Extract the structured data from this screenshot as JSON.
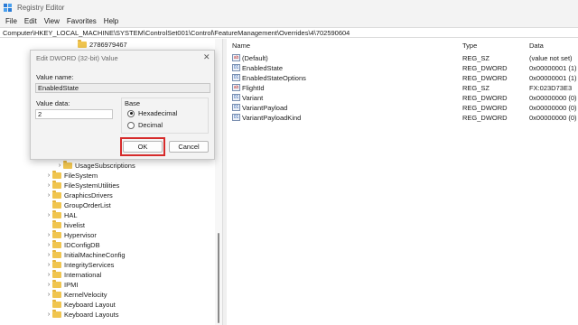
{
  "window": {
    "title": "Registry Editor",
    "icon": "registry-icon"
  },
  "menu": [
    "File",
    "Edit",
    "View",
    "Favorites",
    "Help"
  ],
  "address": "Computer\\HKEY_LOCAL_MACHINE\\SYSTEM\\ControlSet001\\Control\\FeatureManagement\\Overrides\\4\\702590604",
  "tree": {
    "top_item": "2786979467",
    "items": [
      "UsageSubscriptions",
      "FileSystem",
      "FileSystemUtilities",
      "GraphicsDrivers",
      "GroupOrderList",
      "HAL",
      "hivelist",
      "Hypervisor",
      "IDConfigDB",
      "InitialMachineConfig",
      "IntegrityServices",
      "International",
      "IPMI",
      "KernelVelocity",
      "Keyboard Layout",
      "Keyboard Layouts"
    ]
  },
  "list": {
    "headers": {
      "name": "Name",
      "type": "Type",
      "data": "Data"
    },
    "rows": [
      {
        "name": "(Default)",
        "type": "REG_SZ",
        "data": "(value not set)",
        "icon": "ab"
      },
      {
        "name": "EnabledState",
        "type": "REG_DWORD",
        "data": "0x00000001 (1)",
        "icon": "dword"
      },
      {
        "name": "EnabledStateOptions",
        "type": "REG_DWORD",
        "data": "0x00000001 (1)",
        "icon": "dword"
      },
      {
        "name": "FlightId",
        "type": "REG_SZ",
        "data": "FX:023D73E3",
        "icon": "ab"
      },
      {
        "name": "Variant",
        "type": "REG_DWORD",
        "data": "0x00000000 (0)",
        "icon": "dword"
      },
      {
        "name": "VariantPayload",
        "type": "REG_DWORD",
        "data": "0x00000000 (0)",
        "icon": "dword"
      },
      {
        "name": "VariantPayloadKind",
        "type": "REG_DWORD",
        "data": "0x00000000 (0)",
        "icon": "dword"
      }
    ]
  },
  "dialog": {
    "title": "Edit DWORD (32-bit) Value",
    "close": "✕",
    "value_name_label": "Value name:",
    "value_name": "EnabledState",
    "value_data_label": "Value data:",
    "value_data": "2",
    "base_label": "Base",
    "radio_hex": "Hexadecimal",
    "radio_dec": "Decimal",
    "selected_base": "Hexadecimal",
    "ok": "OK",
    "cancel": "Cancel",
    "highlight_color": "#d62b2b"
  }
}
